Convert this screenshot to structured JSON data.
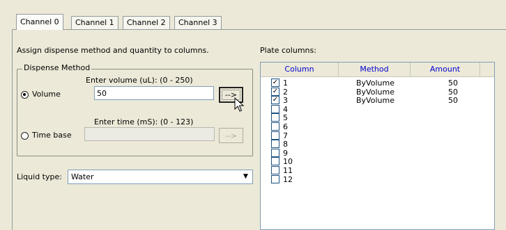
{
  "tabs": [
    {
      "label": "Channel 0",
      "active": true
    },
    {
      "label": "Channel 1",
      "active": false
    },
    {
      "label": "Channel 2",
      "active": false
    },
    {
      "label": "Channel 3",
      "active": false
    }
  ],
  "instructions": "Assign dispense method and quantity to columns.",
  "dispense": {
    "group_title": "Dispense Method",
    "volume_label": "Volume",
    "volume_selected": true,
    "volume_prompt": "Enter volume (uL): (0 - 250)",
    "volume_value": "50",
    "volume_button": "-->",
    "time_label": "Time base",
    "time_selected": false,
    "time_prompt": "Enter time (mS): (0 - 123)",
    "time_value": "",
    "time_button": "-->"
  },
  "liquid": {
    "label": "Liquid type:",
    "value": "Water"
  },
  "plate": {
    "label": "Plate columns:",
    "headers": {
      "column": "Column",
      "method": "Method",
      "amount": "Amount"
    },
    "rows": [
      {
        "column": "1",
        "checked": true,
        "method": "ByVolume",
        "amount": "50"
      },
      {
        "column": "2",
        "checked": true,
        "method": "ByVolume",
        "amount": "50"
      },
      {
        "column": "3",
        "checked": true,
        "method": "ByVolume",
        "amount": "50"
      },
      {
        "column": "4",
        "checked": false,
        "method": "",
        "amount": ""
      },
      {
        "column": "5",
        "checked": false,
        "method": "",
        "amount": ""
      },
      {
        "column": "6",
        "checked": false,
        "method": "",
        "amount": ""
      },
      {
        "column": "7",
        "checked": false,
        "method": "",
        "amount": ""
      },
      {
        "column": "8",
        "checked": false,
        "method": "",
        "amount": ""
      },
      {
        "column": "9",
        "checked": false,
        "method": "",
        "amount": ""
      },
      {
        "column": "10",
        "checked": false,
        "method": "",
        "amount": ""
      },
      {
        "column": "11",
        "checked": false,
        "method": "",
        "amount": ""
      },
      {
        "column": "12",
        "checked": false,
        "method": "",
        "amount": ""
      }
    ]
  },
  "icons": {
    "cursor": "mouse-pointer-icon",
    "dropdown": "chevron-down-icon",
    "check": "checkmark-icon"
  }
}
